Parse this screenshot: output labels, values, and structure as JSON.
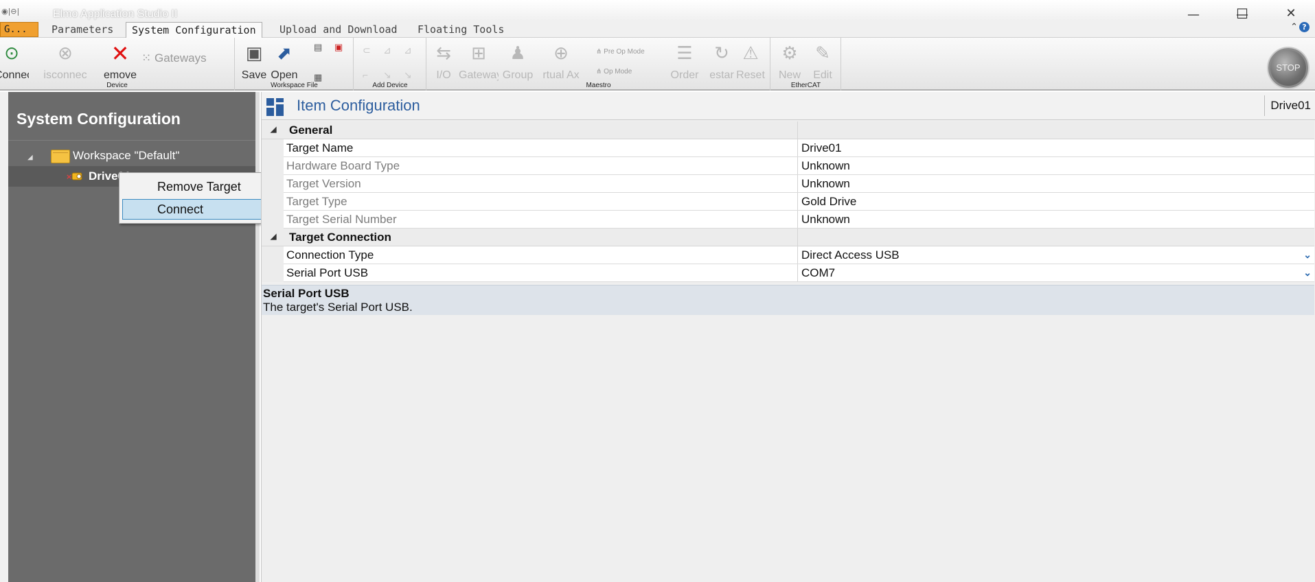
{
  "window": {
    "title": "Elmo Application Studio II",
    "minimize_glyph": "—",
    "maximize_glyph": "☐",
    "close_glyph": "✕"
  },
  "menu": {
    "app_button": "G...",
    "tabs": [
      {
        "label": "Parameters",
        "active": false
      },
      {
        "label": "System Configuration",
        "active": true
      },
      {
        "label": "Upload and Download",
        "active": false
      },
      {
        "label": "Floating Tools",
        "active": false
      }
    ],
    "help_glyph": "?"
  },
  "ribbon": {
    "groups": {
      "device": "Device",
      "workspace_file": "Workspace File",
      "add_device": "Add Device",
      "maestro": "Maestro",
      "ethercat": "EtherCAT"
    },
    "buttons": {
      "connect": "Connec",
      "disconnect": "isconnec",
      "remove": "emove",
      "gateways": "Gateways",
      "save": "Save",
      "open": "Open",
      "io": "I/O",
      "gateway": "Gateway",
      "group": "Group",
      "virtual_axis": "rtual Ax",
      "pre_op_mode": "Pre Op Mode",
      "op_mode": "Op Mode",
      "order": "Order",
      "restart": "estar",
      "reset": "Reset",
      "new": "New",
      "edit": "Edit"
    },
    "stop": "STOP"
  },
  "left_panel": {
    "title": "System Configuration",
    "workspace": "Workspace \"Default\"",
    "drive": "Drive01"
  },
  "context_menu": {
    "items": [
      "Remove Target",
      "Connect"
    ]
  },
  "item_config": {
    "title": "Item Configuration",
    "badge": "Drive01",
    "categories": [
      {
        "name": "General",
        "rows": [
          {
            "name": "Target Name",
            "value": "Drive01"
          },
          {
            "name": "Hardware Board Type",
            "value": "Unknown"
          },
          {
            "name": "Target Version",
            "value": "Unknown"
          },
          {
            "name": "Target Type",
            "value": "Gold Drive"
          },
          {
            "name": "Target Serial Number",
            "value": "Unknown"
          }
        ]
      },
      {
        "name": "Target Connection",
        "rows": [
          {
            "name": "Connection Type",
            "value": "Direct Access USB"
          },
          {
            "name": "Serial Port USB",
            "value": "COM7"
          }
        ]
      }
    ],
    "description": {
      "title": "Serial Port USB",
      "text": "The target's Serial Port USB."
    }
  },
  "colors": {
    "accent": "#2c5d9e",
    "app_button": "#f0a030",
    "panel_dark": "#6b6b6b",
    "selection": "#c7e0f0"
  }
}
